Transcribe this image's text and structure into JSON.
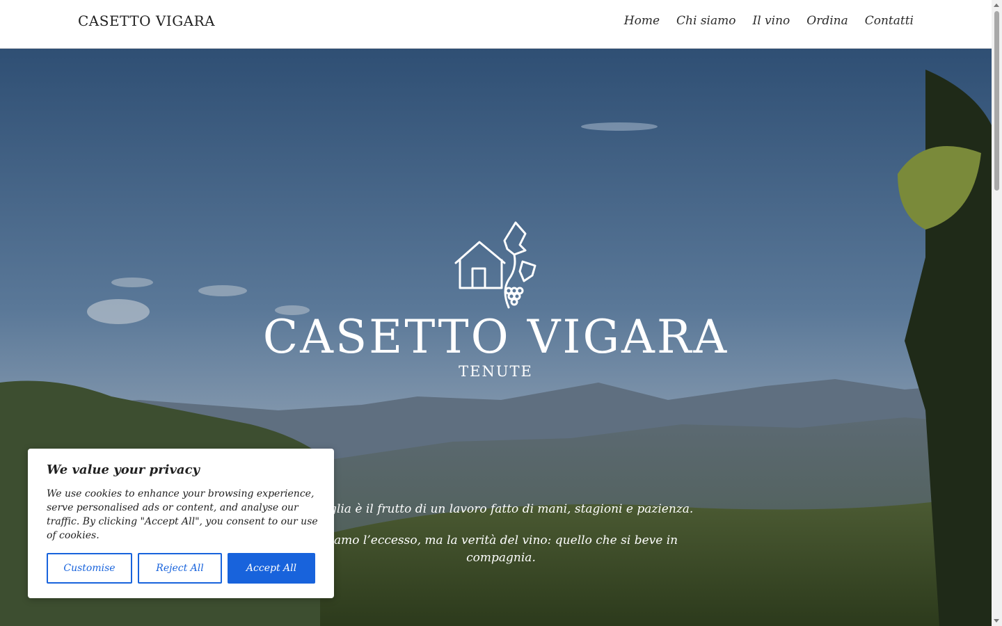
{
  "header": {
    "brand": "CASETTO VIGARA",
    "nav": [
      "Home",
      "Chi siamo",
      "Il vino",
      "Ordina",
      "Contatti"
    ]
  },
  "hero": {
    "logo_title": "CASETTO VIGARA",
    "logo_subtitle": "TENUTE",
    "tagline": [
      "ottiglia è il frutto di un lavoro fatto di mani, stagioni e pazienza.",
      "siamo l’eccesso, ma la verità del vino: quello che si beve in compagnia."
    ]
  },
  "cookie_banner": {
    "title": "We value your privacy",
    "text": "We use cookies to enhance your browsing experience, serve personalised ads or content, and analyse our traffic. By clicking \"Accept All\", you consent to our use of cookies.",
    "customise": "Customise",
    "reject": "Reject All",
    "accept": "Accept All",
    "accent_color": "#1863dc"
  },
  "icons": [
    "house-grape-logo-icon",
    "scroll-up-icon",
    "scroll-down-icon"
  ]
}
